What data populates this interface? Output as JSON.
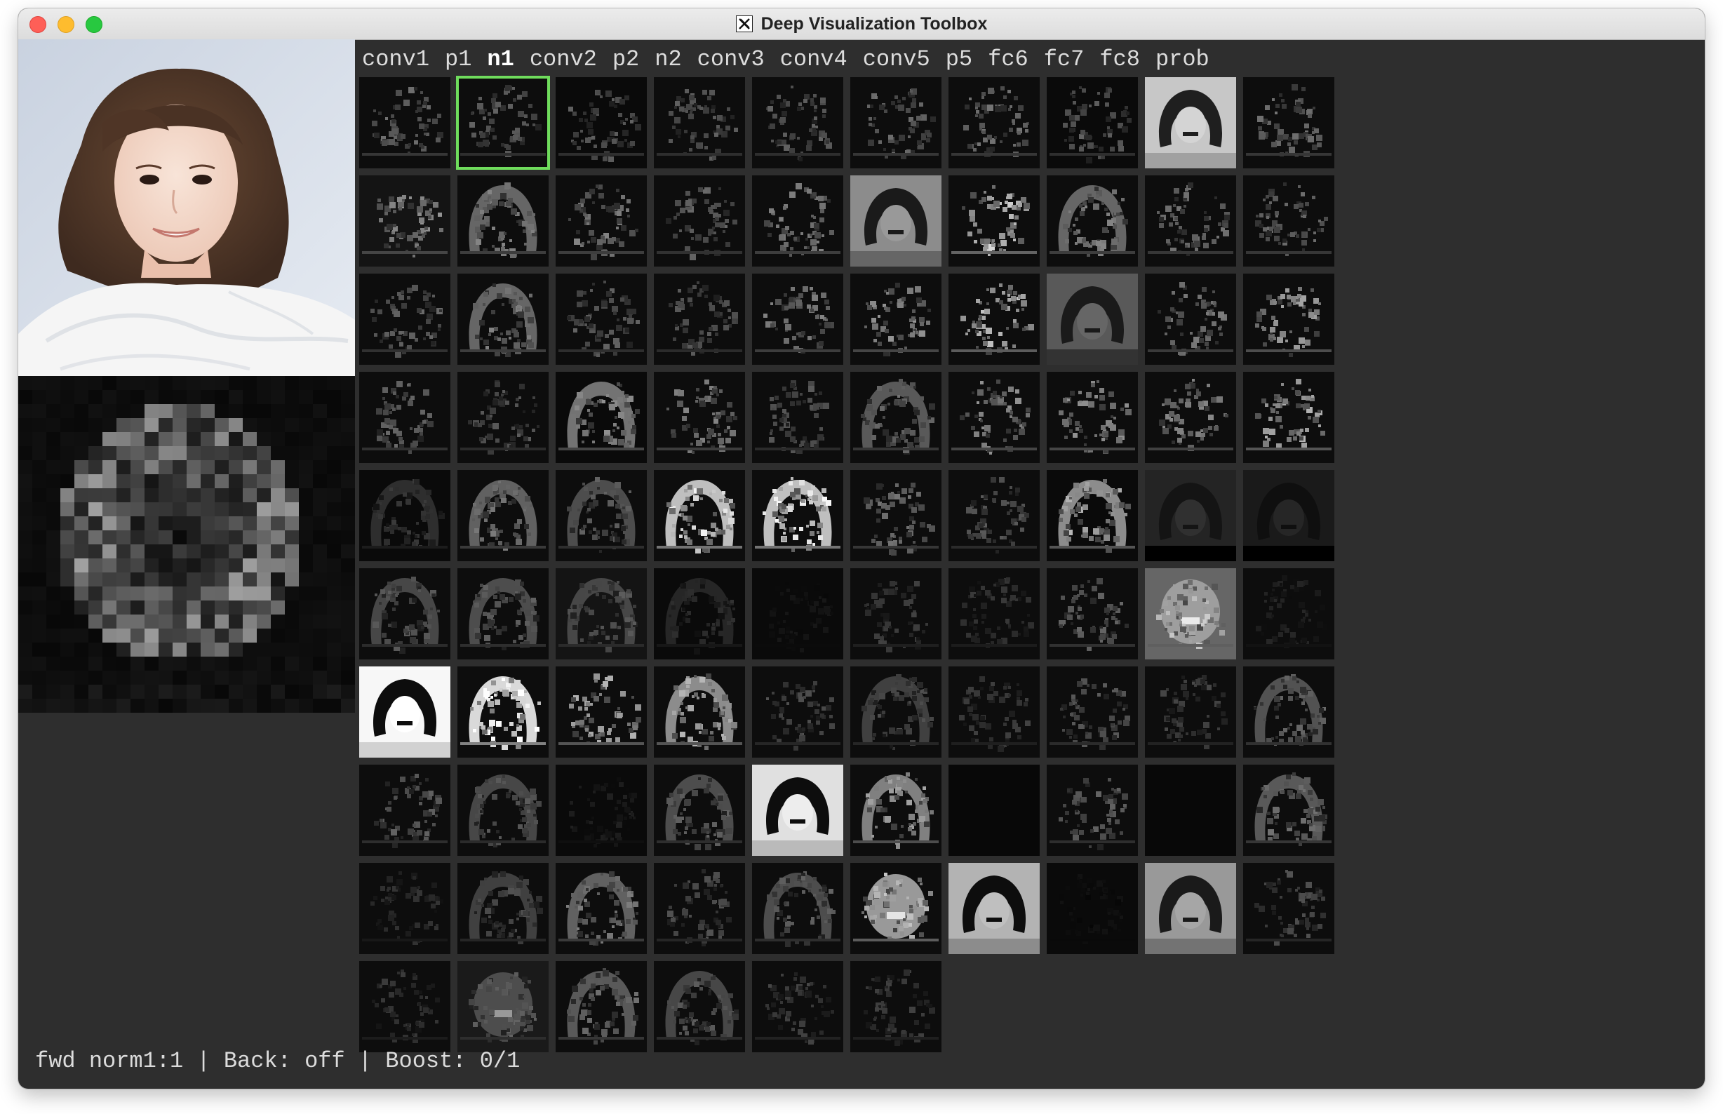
{
  "window": {
    "title": "Deep Visualization Toolbox",
    "title_icon": "x11-icon"
  },
  "layers": [
    {
      "label": "conv1",
      "active": false
    },
    {
      "label": "p1",
      "active": false
    },
    {
      "label": "n1",
      "active": true
    },
    {
      "label": "conv2",
      "active": false
    },
    {
      "label": "p2",
      "active": false
    },
    {
      "label": "n2",
      "active": false
    },
    {
      "label": "conv3",
      "active": false
    },
    {
      "label": "conv4",
      "active": false
    },
    {
      "label": "conv5",
      "active": false
    },
    {
      "label": "p5",
      "active": false
    },
    {
      "label": "fc6",
      "active": false
    },
    {
      "label": "fc7",
      "active": false
    },
    {
      "label": "fc8",
      "active": false
    },
    {
      "label": "prob",
      "active": false
    }
  ],
  "grid": {
    "columns": 10,
    "unit_count": 96,
    "selected_unit": 1,
    "tiles": [
      {
        "bg": 0.05,
        "br": 0.35,
        "k": "hair"
      },
      {
        "bg": 0.05,
        "br": 0.3,
        "k": "hair"
      },
      {
        "bg": 0.04,
        "br": 0.3,
        "k": "hair"
      },
      {
        "bg": 0.05,
        "br": 0.3,
        "k": "hair"
      },
      {
        "bg": 0.05,
        "br": 0.3,
        "k": "hair"
      },
      {
        "bg": 0.05,
        "br": 0.35,
        "k": "hair"
      },
      {
        "bg": 0.05,
        "br": 0.35,
        "k": "hair"
      },
      {
        "bg": 0.04,
        "br": 0.3,
        "k": "hair"
      },
      {
        "bg": 0.78,
        "br": 0.12,
        "k": "inv"
      },
      {
        "bg": 0.05,
        "br": 0.35,
        "k": "hair"
      },
      {
        "bg": 0.08,
        "br": 0.45,
        "k": "hair"
      },
      {
        "bg": 0.05,
        "br": 0.4,
        "k": "arch"
      },
      {
        "bg": 0.05,
        "br": 0.4,
        "k": "hair"
      },
      {
        "bg": 0.05,
        "br": 0.32,
        "k": "hair"
      },
      {
        "bg": 0.05,
        "br": 0.4,
        "k": "hair"
      },
      {
        "bg": 0.55,
        "br": 0.1,
        "k": "inv"
      },
      {
        "bg": 0.05,
        "br": 0.65,
        "k": "hair"
      },
      {
        "bg": 0.05,
        "br": 0.4,
        "k": "arch"
      },
      {
        "bg": 0.05,
        "br": 0.35,
        "k": "hair"
      },
      {
        "bg": 0.05,
        "br": 0.35,
        "k": "hair"
      },
      {
        "bg": 0.05,
        "br": 0.32,
        "k": "hair"
      },
      {
        "bg": 0.05,
        "br": 0.4,
        "k": "arch"
      },
      {
        "bg": 0.05,
        "br": 0.3,
        "k": "hair"
      },
      {
        "bg": 0.05,
        "br": 0.28,
        "k": "hair"
      },
      {
        "bg": 0.05,
        "br": 0.4,
        "k": "hair"
      },
      {
        "bg": 0.05,
        "br": 0.45,
        "k": "hair"
      },
      {
        "bg": 0.05,
        "br": 0.6,
        "k": "hair"
      },
      {
        "bg": 0.35,
        "br": 0.1,
        "k": "inv"
      },
      {
        "bg": 0.05,
        "br": 0.38,
        "k": "hair"
      },
      {
        "bg": 0.05,
        "br": 0.5,
        "k": "hair"
      },
      {
        "bg": 0.05,
        "br": 0.32,
        "k": "hair"
      },
      {
        "bg": 0.05,
        "br": 0.28,
        "k": "hair"
      },
      {
        "bg": 0.04,
        "br": 0.45,
        "k": "arch"
      },
      {
        "bg": 0.05,
        "br": 0.4,
        "k": "hair"
      },
      {
        "bg": 0.05,
        "br": 0.28,
        "k": "hair"
      },
      {
        "bg": 0.05,
        "br": 0.35,
        "k": "arch"
      },
      {
        "bg": 0.05,
        "br": 0.45,
        "k": "hair"
      },
      {
        "bg": 0.05,
        "br": 0.45,
        "k": "hair"
      },
      {
        "bg": 0.05,
        "br": 0.42,
        "k": "hair"
      },
      {
        "bg": 0.05,
        "br": 0.55,
        "k": "hair"
      },
      {
        "bg": 0.04,
        "br": 0.18,
        "k": "arch"
      },
      {
        "bg": 0.05,
        "br": 0.38,
        "k": "arch"
      },
      {
        "bg": 0.05,
        "br": 0.3,
        "k": "arch"
      },
      {
        "bg": 0.05,
        "br": 0.75,
        "k": "arch"
      },
      {
        "bg": 0.05,
        "br": 0.75,
        "k": "arch"
      },
      {
        "bg": 0.05,
        "br": 0.35,
        "k": "hair"
      },
      {
        "bg": 0.05,
        "br": 0.28,
        "k": "hair"
      },
      {
        "bg": 0.04,
        "br": 0.55,
        "k": "arch"
      },
      {
        "bg": 0.14,
        "br": 0.08,
        "k": "inv"
      },
      {
        "bg": 0.1,
        "br": 0.06,
        "k": "inv"
      },
      {
        "bg": 0.05,
        "br": 0.28,
        "k": "arch"
      },
      {
        "bg": 0.05,
        "br": 0.3,
        "k": "arch"
      },
      {
        "bg": 0.08,
        "br": 0.28,
        "k": "arch"
      },
      {
        "bg": 0.04,
        "br": 0.15,
        "k": "arch"
      },
      {
        "bg": 0.04,
        "br": 0.07,
        "k": "hair"
      },
      {
        "bg": 0.05,
        "br": 0.2,
        "k": "hair"
      },
      {
        "bg": 0.05,
        "br": 0.18,
        "k": "hair"
      },
      {
        "bg": 0.05,
        "br": 0.32,
        "k": "hair"
      },
      {
        "bg": 0.4,
        "br": 0.62,
        "k": "blob"
      },
      {
        "bg": 0.05,
        "br": 0.12,
        "k": "hair"
      },
      {
        "bg": 0.97,
        "br": 0.05,
        "k": "inv"
      },
      {
        "bg": 0.05,
        "br": 0.85,
        "k": "arch"
      },
      {
        "bg": 0.05,
        "br": 0.55,
        "k": "hair"
      },
      {
        "bg": 0.05,
        "br": 0.55,
        "k": "arch"
      },
      {
        "bg": 0.05,
        "br": 0.25,
        "k": "hair"
      },
      {
        "bg": 0.05,
        "br": 0.25,
        "k": "arch"
      },
      {
        "bg": 0.05,
        "br": 0.2,
        "k": "hair"
      },
      {
        "bg": 0.05,
        "br": 0.28,
        "k": "hair"
      },
      {
        "bg": 0.05,
        "br": 0.22,
        "k": "hair"
      },
      {
        "bg": 0.05,
        "br": 0.32,
        "k": "arch"
      },
      {
        "bg": 0.05,
        "br": 0.3,
        "k": "hair"
      },
      {
        "bg": 0.05,
        "br": 0.28,
        "k": "arch"
      },
      {
        "bg": 0.04,
        "br": 0.1,
        "k": "hair"
      },
      {
        "bg": 0.05,
        "br": 0.3,
        "k": "arch"
      },
      {
        "bg": 0.88,
        "br": 0.05,
        "k": "inv"
      },
      {
        "bg": 0.05,
        "br": 0.5,
        "k": "arch"
      },
      {
        "bg": 0.03,
        "br": 0.0,
        "k": "none"
      },
      {
        "bg": 0.05,
        "br": 0.3,
        "k": "hair"
      },
      {
        "bg": 0.03,
        "br": 0.0,
        "k": "none"
      },
      {
        "bg": 0.05,
        "br": 0.35,
        "k": "arch"
      },
      {
        "bg": 0.05,
        "br": 0.16,
        "k": "hair"
      },
      {
        "bg": 0.05,
        "br": 0.25,
        "k": "arch"
      },
      {
        "bg": 0.05,
        "br": 0.38,
        "k": "arch"
      },
      {
        "bg": 0.05,
        "br": 0.25,
        "k": "hair"
      },
      {
        "bg": 0.05,
        "br": 0.3,
        "k": "arch"
      },
      {
        "bg": 0.05,
        "br": 0.6,
        "k": "blob"
      },
      {
        "bg": 0.7,
        "br": 0.05,
        "k": "inv"
      },
      {
        "bg": 0.04,
        "br": 0.06,
        "k": "hair"
      },
      {
        "bg": 0.6,
        "br": 0.1,
        "k": "inv"
      },
      {
        "bg": 0.05,
        "br": 0.25,
        "k": "hair"
      },
      {
        "bg": 0.05,
        "br": 0.18,
        "k": "hair"
      },
      {
        "bg": 0.1,
        "br": 0.3,
        "k": "blob"
      },
      {
        "bg": 0.05,
        "br": 0.35,
        "k": "arch"
      },
      {
        "bg": 0.05,
        "br": 0.28,
        "k": "arch"
      },
      {
        "bg": 0.05,
        "br": 0.22,
        "k": "hair"
      },
      {
        "bg": 0.05,
        "br": 0.2,
        "k": "hair"
      }
    ]
  },
  "status": {
    "text": "fwd norm1:1 | Back: off | Boost: 0/1"
  }
}
